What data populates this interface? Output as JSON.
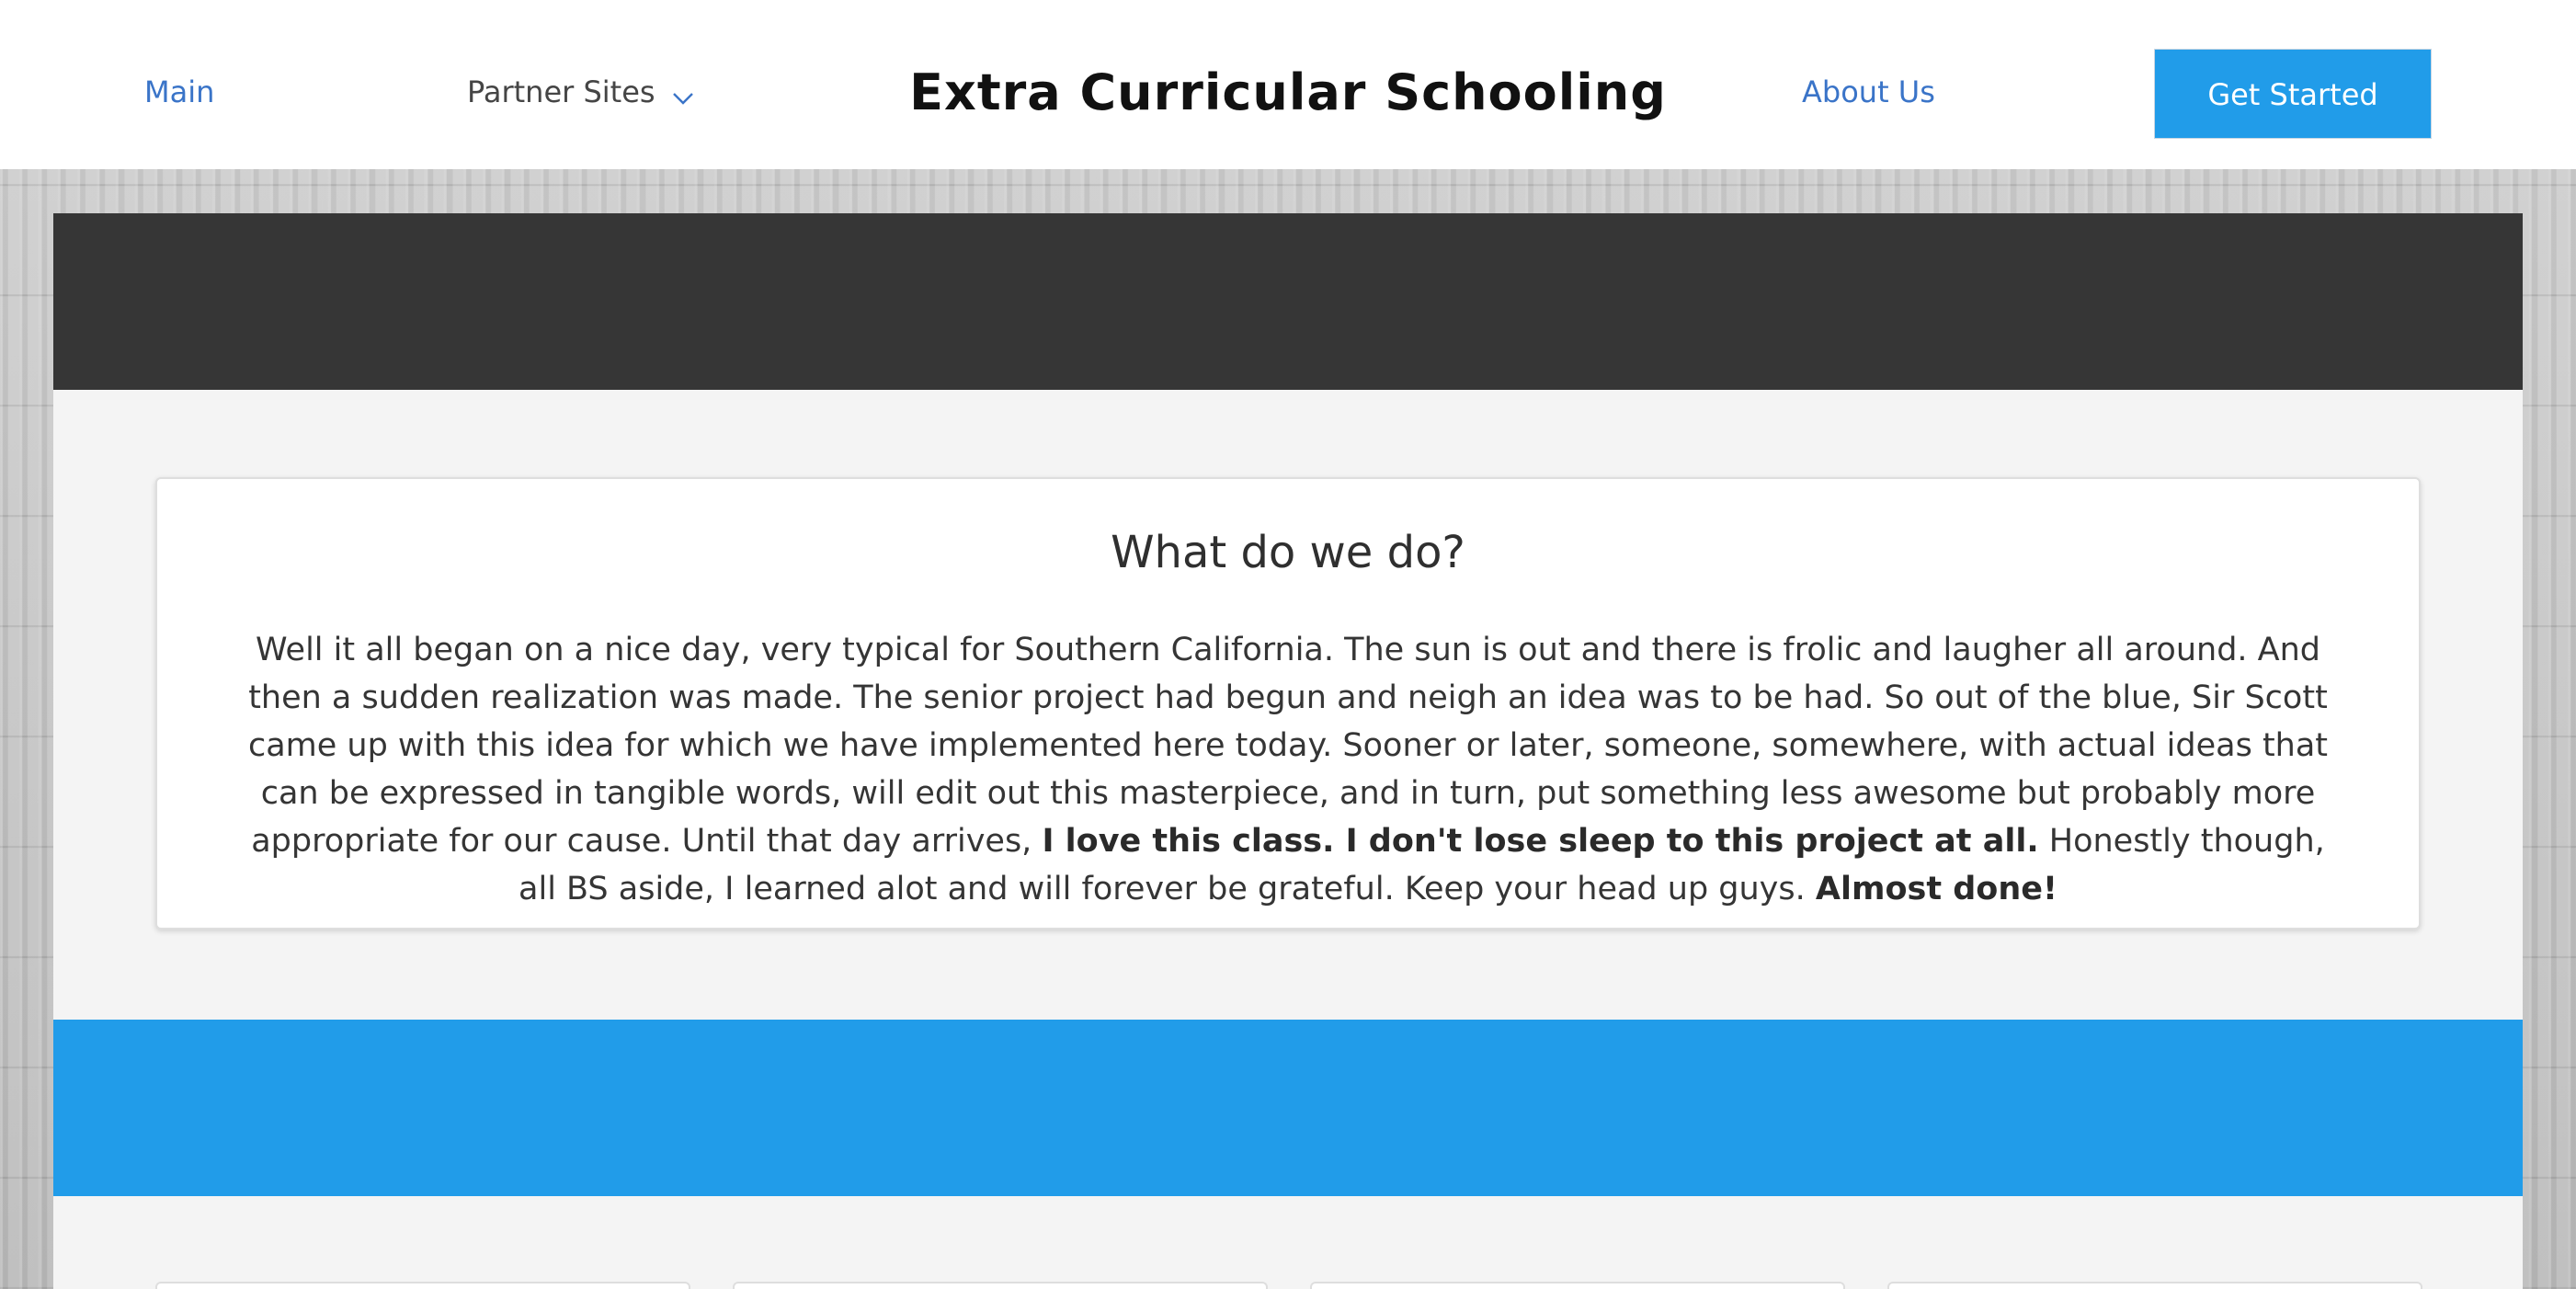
{
  "header": {
    "nav": {
      "main": "Main",
      "partner_sites": "Partner Sites",
      "about_us": "About Us"
    },
    "site_title": "Extra Curricular Schooling",
    "cta_label": "Get Started"
  },
  "card": {
    "title": "What do we do?",
    "paragraph": {
      "part1": "Well it all began on a nice day, very typical for Southern California. The sun is out and there is frolic and laugher all around. And then a sudden realization was made. The senior project had begun and neigh an idea was to be had. So out of the blue, Sir Scott came up with this idea for which we have implemented here today. Sooner or later, someone, somewhere, with actual ideas that can be expressed in tangible words, will edit out this masterpiece, and in turn, put something less awesome but probably more appropriate for our cause. Until that day arrives, ",
      "bold1": "I love this class. I don't lose sleep to this project at all.",
      "part2": " Honestly though, all BS aside, I learned alot and will forever be grateful. Keep your head up guys. ",
      "bold2": "Almost done!"
    }
  },
  "icons": {
    "partner_sites_dropdown": "chevron-down-icon"
  },
  "colors": {
    "accent_blue": "#219ce9",
    "nav_link_blue": "#3a74c8",
    "dark_band": "#363636",
    "column_bg": "#f4f4f4"
  }
}
